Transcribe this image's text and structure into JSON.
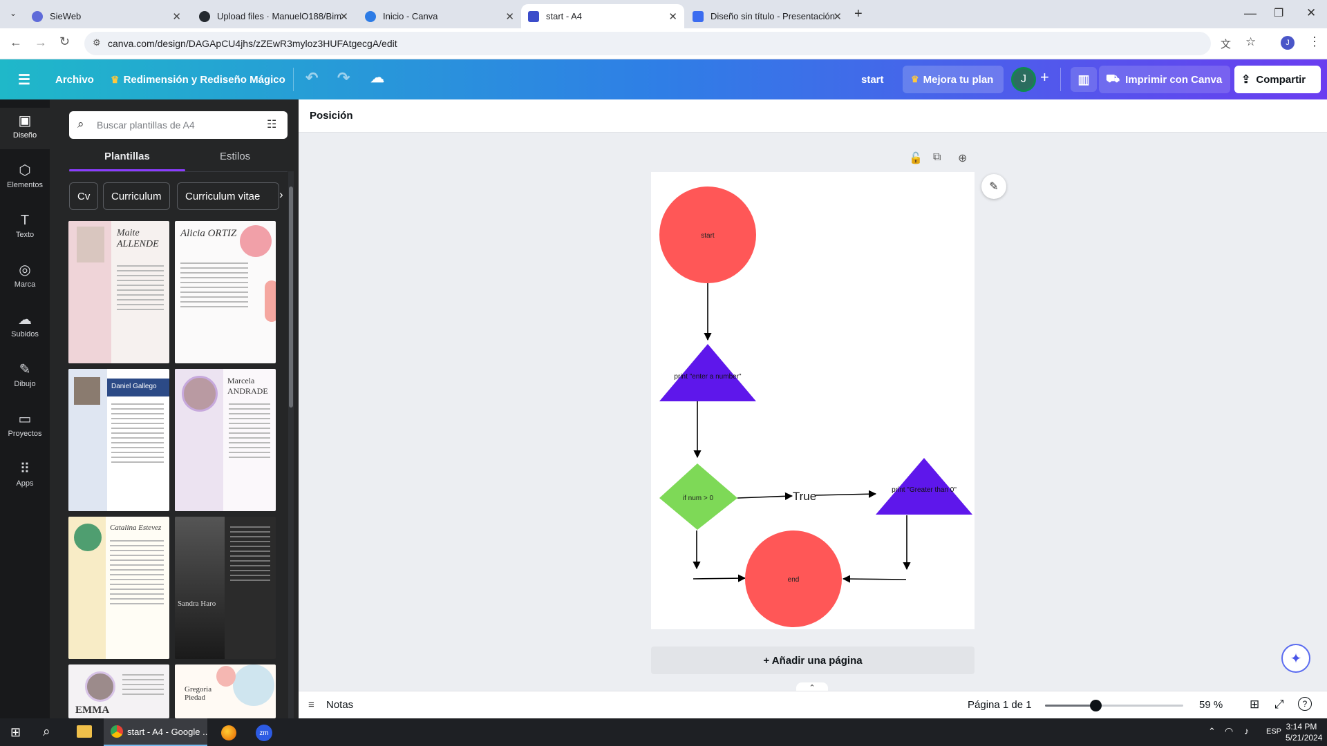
{
  "browser": {
    "tabs": [
      {
        "label": "SieWeb",
        "icon": "globe-icon",
        "color": "#5f6bd9"
      },
      {
        "label": "Upload files · ManuelO188/Bim",
        "icon": "github-icon",
        "color": "#24292f"
      },
      {
        "label": "Inicio - Canva",
        "icon": "canva-icon",
        "color": "#2c7be5"
      },
      {
        "label": "start - A4",
        "icon": "canva-doc-icon",
        "color": "#3b4cca"
      },
      {
        "label": "Diseño sin título - Presentación",
        "icon": "canva-slides-icon",
        "color": "#3b6cf0"
      }
    ],
    "url": "canva.com/design/DAGApCU4jhs/zZEwR3myloz3HUFAtgecgA/edit",
    "profile_initial": "J"
  },
  "header": {
    "menu_file": "Archivo",
    "magic_resize": "Redimensión y Rediseño Mágico",
    "doc_title": "start",
    "upgrade": "Mejora tu plan",
    "avatar_initial": "J",
    "print": "Imprimir con Canva",
    "share": "Compartir"
  },
  "rail": {
    "items": [
      {
        "label": "Diseño",
        "icon": "design-icon"
      },
      {
        "label": "Elementos",
        "icon": "elements-icon"
      },
      {
        "label": "Texto",
        "icon": "text-icon"
      },
      {
        "label": "Marca",
        "icon": "brand-icon"
      },
      {
        "label": "Subidos",
        "icon": "uploads-icon"
      },
      {
        "label": "Dibujo",
        "icon": "draw-icon"
      },
      {
        "label": "Proyectos",
        "icon": "folder-icon"
      },
      {
        "label": "Apps",
        "icon": "apps-icon"
      }
    ]
  },
  "panel": {
    "search_placeholder": "Buscar plantillas de A4",
    "tab_templates": "Plantillas",
    "tab_styles": "Estilos",
    "chips": [
      "Cv",
      "Curriculum",
      "Curriculum vitae"
    ],
    "templates": [
      {
        "title": "Maite ALLENDE",
        "bg": "#f6f1ef",
        "accent": "#e9c9cf"
      },
      {
        "title": "Alicia ORTIZ",
        "bg": "#fbfafa",
        "accent": "#f1a0a8"
      },
      {
        "title": "Daniel Gallego",
        "bg": "#ffffff",
        "accent": "#2c4a86"
      },
      {
        "title": "Marcela ANDRADE",
        "bg": "#fbf8fb",
        "accent": "#c7a9dd"
      },
      {
        "title": "Catalina Estevez",
        "bg": "#fffdf5",
        "accent": "#f5d77a"
      },
      {
        "title": "Sandra Haro",
        "bg": "#2b2b2b",
        "accent": "#6b6b6b"
      },
      {
        "title": "EMMA",
        "bg": "#f4f2f4",
        "accent": "#d7c3e6"
      },
      {
        "title": "Gregoria Piedad",
        "bg": "#fffaf4",
        "accent": "#f5b7b2"
      }
    ]
  },
  "toolbar": {
    "position_label": "Posición"
  },
  "flowchart": {
    "start": "start",
    "input": "print \"enter a number\"",
    "decision": "if num > 0",
    "true_label": "True",
    "output": "print \"Greater than 0\"",
    "end": "end",
    "terminal_color": "#ff5757",
    "process_color": "#5e17eb",
    "decision_color": "#7ed957"
  },
  "canvas": {
    "add_page": "+ Añadir una página"
  },
  "footer": {
    "notes": "Notas",
    "page_indicator": "Página 1 de 1",
    "zoom": "59 %",
    "zoom_level": 0.59
  },
  "taskbar": {
    "active_app": "start - A4 - Google ...",
    "lang": "ESP",
    "time": "3:14 PM",
    "date": "5/21/2024"
  }
}
